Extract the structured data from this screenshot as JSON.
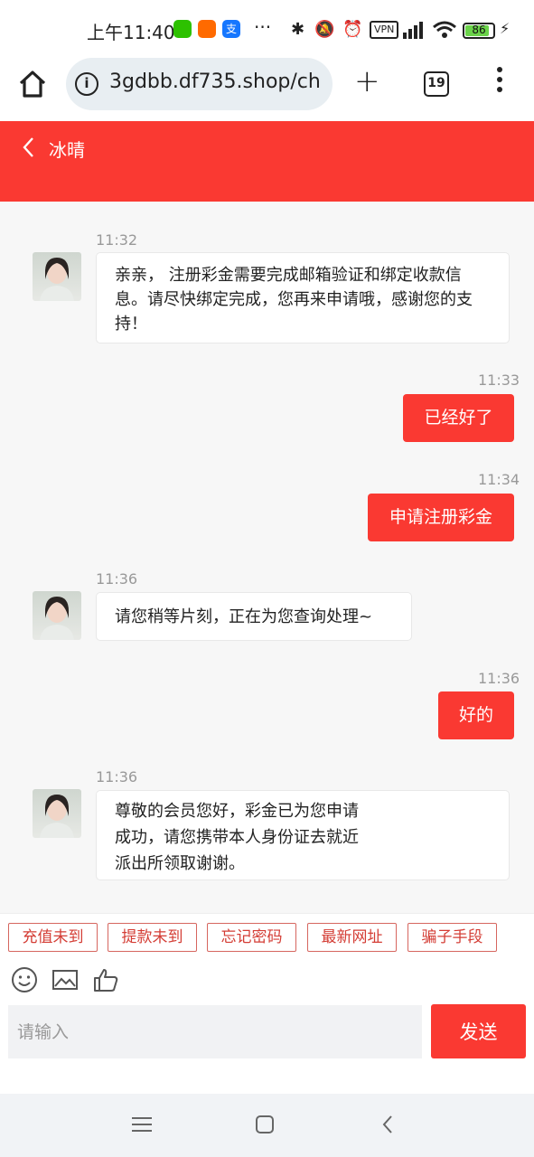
{
  "status_bar": {
    "time": "上午11:40",
    "vpn": "VPN",
    "battery": "86",
    "battery_level": 0.86
  },
  "browser": {
    "url": "3gdbb.df735.shop/ch",
    "tab_count": "19"
  },
  "header": {
    "title": "冰晴"
  },
  "messages": [
    {
      "side": "in",
      "time": "11:32",
      "text": "亲亲， 注册彩金需要完成邮箱验证和绑定收款信息。请尽快绑定完成，您再来申请哦，感谢您的支持！"
    },
    {
      "side": "out",
      "time": "11:33",
      "text": "已经好了"
    },
    {
      "side": "out",
      "time": "11:34",
      "text": "申请注册彩金"
    },
    {
      "side": "in",
      "time": "11:36",
      "text": "请您稍等片刻，正在为您查询处理~"
    },
    {
      "side": "out",
      "time": "11:36",
      "text": "好的"
    },
    {
      "side": "in",
      "time": "11:36",
      "text": "尊敬的会员您好，彩金已为您申请成功，请您携带本人身份证去就近派出所领取谢谢。"
    }
  ],
  "quick_replies": [
    "充值未到",
    "提款未到",
    "忘记密码",
    "最新网址",
    "骗子手段"
  ],
  "input": {
    "placeholder": "请输入",
    "send_label": "发送"
  },
  "colors": {
    "accent": "#fa3932",
    "quick_border": "#d6665f"
  }
}
